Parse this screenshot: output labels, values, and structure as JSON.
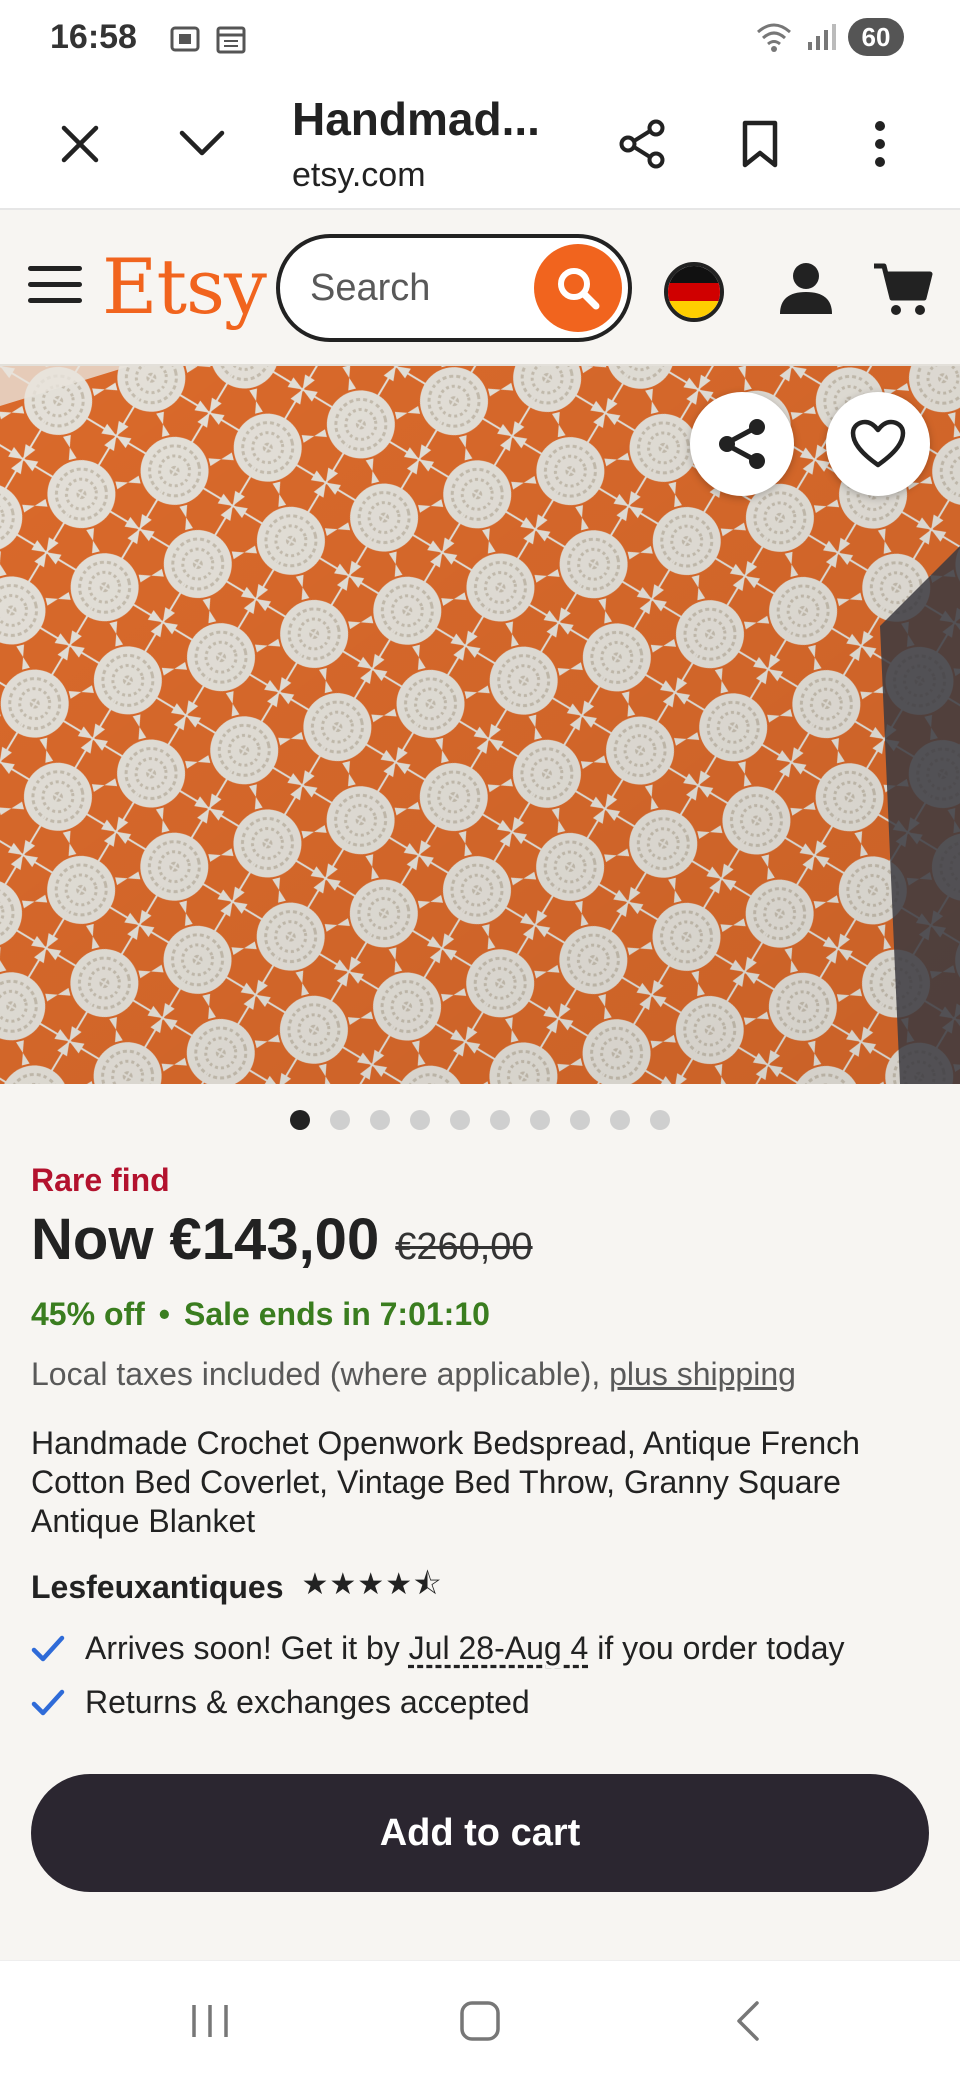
{
  "status_bar": {
    "time": "16:58",
    "battery": "60"
  },
  "browser": {
    "title": "Handmad...",
    "url": "etsy.com"
  },
  "header": {
    "logo": "Etsy",
    "search_placeholder": "Search",
    "brand_color": "#f1641e"
  },
  "gallery": {
    "dot_count": 10,
    "active_index": 0
  },
  "listing": {
    "rare_label": "Rare find",
    "price_now": "Now €143,00",
    "price_old": "€260,00",
    "discount": "45% off",
    "sale_separator": "•",
    "sale_ends": "Sale ends in 7:01:10",
    "taxes_prefix": "Local taxes included (where applicable), ",
    "taxes_link": "plus shipping",
    "title": "Handmade Crochet Openwork Bedspread, Antique French Cotton Bed Coverlet, Vintage Bed Throw, Granny Square Antique Blanket",
    "shop_name": "Lesfeuxantiques",
    "rating": 4.5,
    "rating_stars": "★★★★⯪",
    "arrives_prefix": "Arrives soon! Get it by ",
    "arrives_dates": "Jul 28-Aug 4",
    "arrives_suffix": " if you order today",
    "returns": "Returns & exchanges accepted",
    "add_to_cart": "Add to cart"
  },
  "colors": {
    "sale_green": "#3a7d1f",
    "rare_red": "#b3122e",
    "check_blue": "#2f6bd8",
    "button_dark": "#2b2630"
  }
}
